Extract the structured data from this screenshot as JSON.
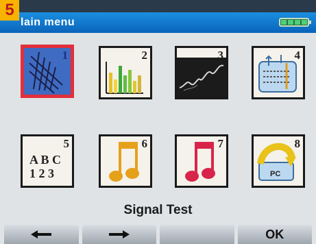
{
  "badge": {
    "number": "5"
  },
  "header": {
    "title": "lain  menu",
    "battery_level": 1.0
  },
  "colors": {
    "title_bar": "#0a63b9",
    "selected_border": "#e2303b",
    "selected_fill": "#3f6cc2"
  },
  "menu": {
    "tiles": [
      {
        "number": "1",
        "icon": "spectrum-hatch-icon",
        "selected": true
      },
      {
        "number": "2",
        "icon": "bar-graph-icon",
        "selected": false
      },
      {
        "number": "3",
        "icon": "signal-trace-icon",
        "selected": false
      },
      {
        "number": "4",
        "icon": "table-probe-icon",
        "selected": false
      },
      {
        "number": "5",
        "icon": "abc-123-icon",
        "text_line1": "A B C",
        "text_line2": "1 2 3",
        "selected": false
      },
      {
        "number": "6",
        "icon": "music-note-yellow-icon",
        "selected": false
      },
      {
        "number": "7",
        "icon": "music-note-red-icon",
        "selected": false
      },
      {
        "number": "8",
        "icon": "pc-transfer-icon",
        "pc_label": "PC",
        "selected": false
      }
    ]
  },
  "selected_label": "Signal  Test",
  "softkeys": [
    {
      "icon": "arrow-left-icon",
      "label": ""
    },
    {
      "icon": "arrow-right-icon",
      "label": ""
    },
    {
      "icon": "",
      "label": ""
    },
    {
      "icon": "",
      "label": "OK"
    }
  ]
}
